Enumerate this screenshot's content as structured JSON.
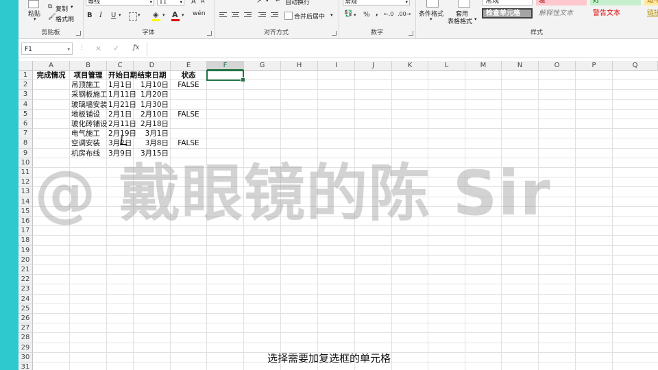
{
  "ribbon": {
    "clipboard": {
      "paste": "粘贴",
      "copy": "复制",
      "format_painter": "格式刷",
      "label": "剪贴板"
    },
    "font": {
      "font_name": "等线",
      "font_size": "11",
      "bold": "B",
      "italic": "I",
      "underline": "U",
      "grow": "A",
      "phonetic": "wén",
      "label": "字体"
    },
    "alignment": {
      "wrap": "自动换行",
      "merge": "合并后居中",
      "label": "对齐方式"
    },
    "number": {
      "format": "常规",
      "percent": "%",
      "comma": ",",
      "label": "数字"
    },
    "styles": {
      "conditional": "条件格式",
      "table_line1": "套用",
      "table_line2": "表格格式",
      "cells": [
        "常规",
        "差",
        "好",
        "适中",
        "检查单元格",
        "解释性文本",
        "警告文本",
        "链接"
      ],
      "label": "样式"
    }
  },
  "formula_bar": {
    "name_box": "F1",
    "cancel": "×",
    "enter": "✓",
    "fx": "fx",
    "value": ""
  },
  "columns": [
    "A",
    "B",
    "C",
    "D",
    "E",
    "F",
    "G",
    "H",
    "I",
    "J",
    "K",
    "L",
    "M",
    "N",
    "O",
    "P",
    "Q"
  ],
  "rows": [
    "1",
    "2",
    "3",
    "4",
    "5",
    "6",
    "7",
    "8",
    "9",
    "10",
    "11",
    "12",
    "13",
    "14",
    "15",
    "16",
    "17",
    "18",
    "19",
    "20",
    "21",
    "22",
    "23",
    "24",
    "25",
    "26",
    "27",
    "28",
    "29",
    "30",
    "31"
  ],
  "sheet": {
    "headers": [
      "完成情况",
      "项目管理",
      "开始日期",
      "结束日期",
      "状态"
    ],
    "data": [
      {
        "b": "吊顶施工",
        "c": "1月1日",
        "d": "1月10日",
        "e": "FALSE"
      },
      {
        "b": "采钢板施工",
        "c": "1月11日",
        "d": "1月20日",
        "e": ""
      },
      {
        "b": "玻璃墙安装",
        "c": "1月21日",
        "d": "1月30日",
        "e": ""
      },
      {
        "b": "地板铺设",
        "c": "2月1日",
        "d": "2月10日",
        "e": "FALSE"
      },
      {
        "b": "玻化砖铺设",
        "c": "2月11日",
        "d": "2月18日",
        "e": ""
      },
      {
        "b": "电气施工",
        "c": "2月19日",
        "d": "3月1日",
        "e": ""
      },
      {
        "b": "空调安装",
        "c": "3月2日",
        "d": "3月8日",
        "e": "FALSE"
      },
      {
        "b": "机房布线",
        "c": "3月9日",
        "d": "3月15日",
        "e": ""
      }
    ],
    "selected_column": "F"
  },
  "watermark": "@ 戴眼镜的陈 Sir",
  "subtitle": "选择需要加复选框的单元格",
  "colors": {
    "accent": "#217346",
    "background": "#2ec9cf",
    "bad": "#ffc7ce",
    "good": "#c6efce",
    "neutral": "#ffeb9c",
    "check_cell": "#a5a5a5"
  }
}
